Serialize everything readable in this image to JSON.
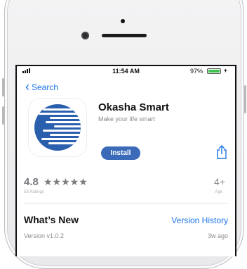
{
  "status_bar": {
    "time": "11:54 AM",
    "battery": "97%"
  },
  "nav": {
    "back_label": "Search"
  },
  "app": {
    "name": "Okasha Smart",
    "tagline": "Make your life smart",
    "install_label": "Install"
  },
  "ratings": {
    "value": "4.8",
    "stars": "★★★★★",
    "count_label": "58 Ratings",
    "age": "4+",
    "age_label": "Age"
  },
  "whats_new": {
    "title": "What’s New",
    "history_link": "Version History",
    "version": "Version v1.0.2",
    "age": "3w ago"
  },
  "colors": {
    "accent": "#1b74e8",
    "install": "#3a6ab8",
    "icon_blue": "#2a5fae"
  }
}
